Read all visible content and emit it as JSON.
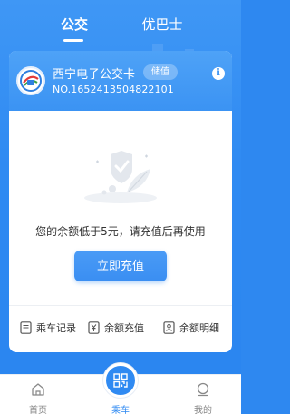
{
  "tabs": [
    {
      "label": "公交"
    },
    {
      "label": "优巴士"
    }
  ],
  "card": {
    "title": "西宁电子公交卡",
    "badge": "储值",
    "number": "NO.1652413504822101"
  },
  "message": "您的余额低于5元，请充值后再使用",
  "recharge_button": "立即充值",
  "actions": [
    {
      "label": "乘车记录",
      "icon": "document-list-icon"
    },
    {
      "label": "余额充值",
      "icon": "yen-recharge-icon"
    },
    {
      "label": "余额明细",
      "icon": "account-detail-icon"
    }
  ],
  "nav": [
    {
      "label": "首页",
      "icon": "home-icon"
    },
    {
      "label": "乘车",
      "icon": "qr-ride-icon"
    },
    {
      "label": "我的",
      "icon": "profile-icon"
    }
  ],
  "colors": {
    "primary": "#2f8af2",
    "card_header": "#3b93f3",
    "text": "#333333"
  }
}
